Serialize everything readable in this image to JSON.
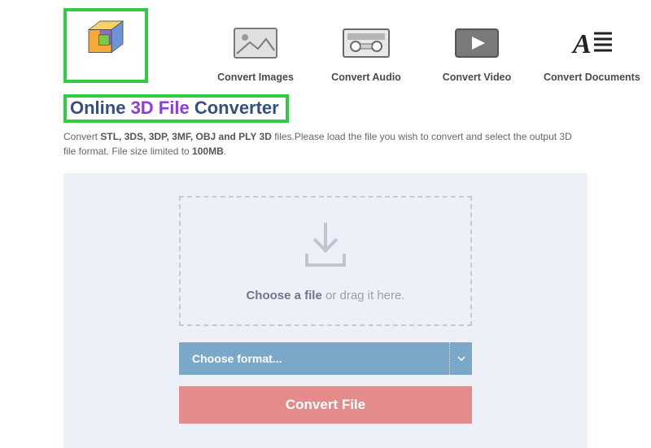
{
  "nav": {
    "items": [
      {
        "label": "Convert Images"
      },
      {
        "label": "Convert Audio"
      },
      {
        "label": "Convert Video"
      },
      {
        "label": "Convert Documents"
      }
    ]
  },
  "title": {
    "part1": "Online ",
    "part2": "3D File ",
    "part3": "Converter"
  },
  "subtitle": {
    "lead": "Convert ",
    "formats": "STL, 3DS, 3DP, 3MF, OBJ and PLY 3D",
    "middle": " files.Please load the file you wish to convert and select the output 3D file format. File size limited to ",
    "limit": "100MB",
    "tail": "."
  },
  "dropzone": {
    "bold": "Choose a file",
    "rest": " or drag it here."
  },
  "format_select": {
    "label": "Choose format..."
  },
  "convert_button": {
    "label": "Convert File"
  }
}
